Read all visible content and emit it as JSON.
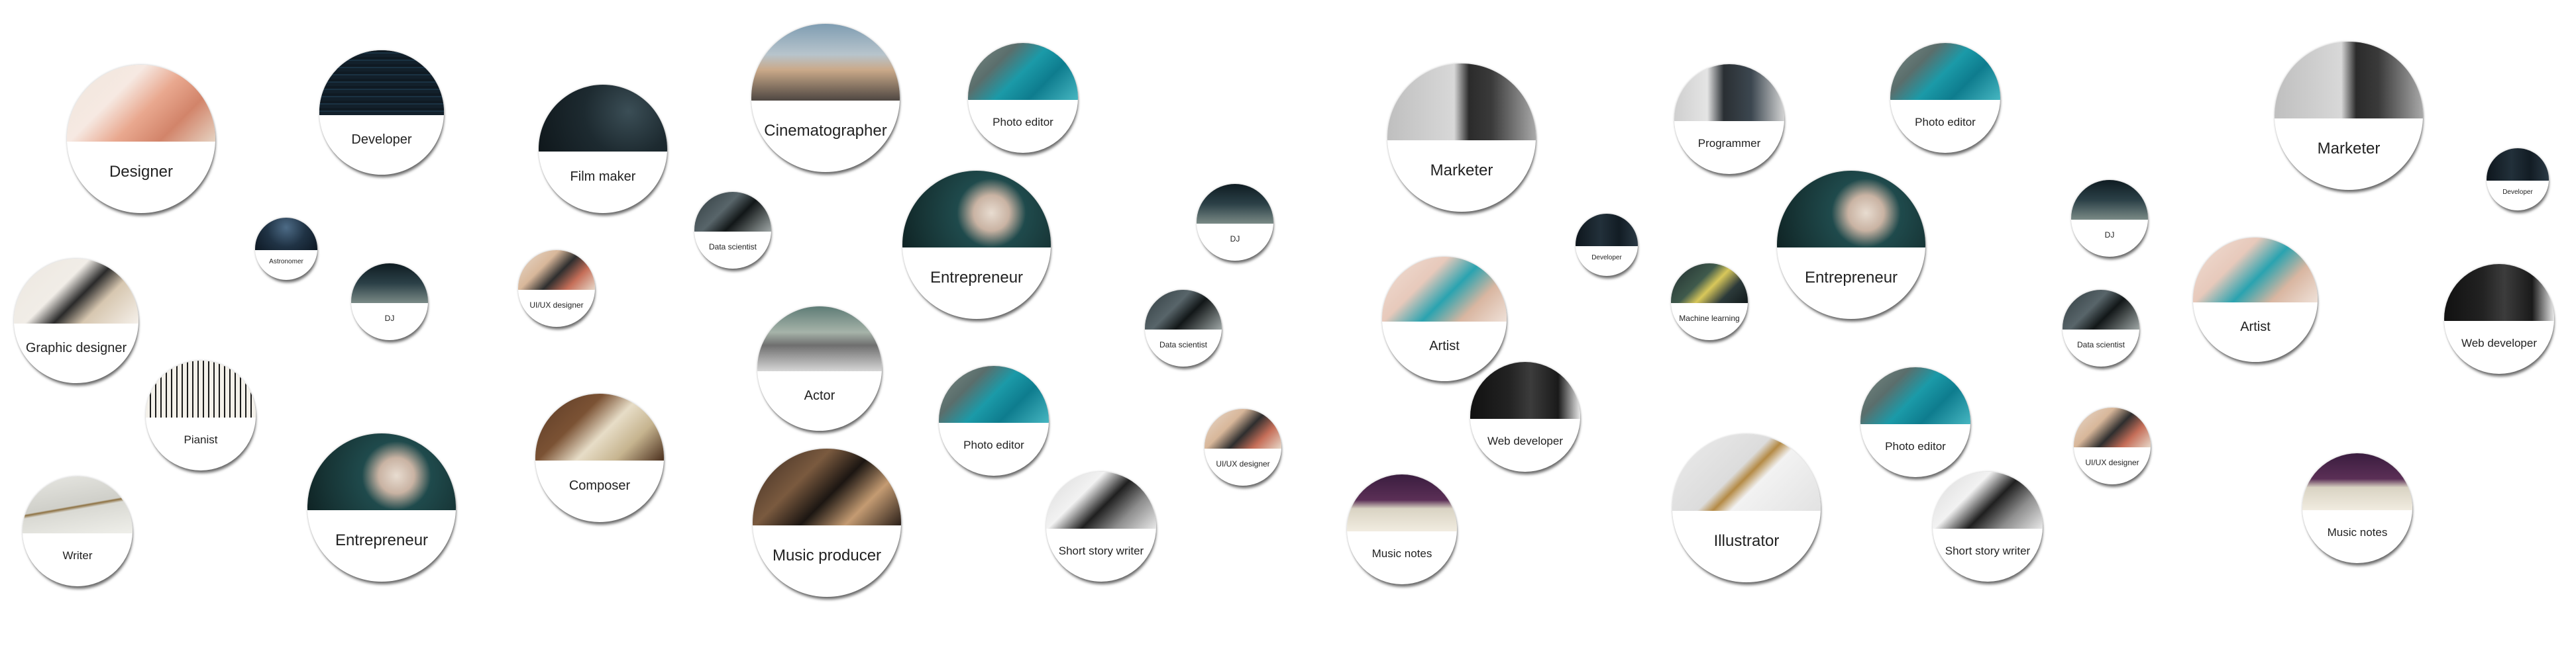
{
  "bubbles": [
    {
      "label": "Designer",
      "theme": "t-designer"
    },
    {
      "label": "Developer",
      "theme": "t-code"
    },
    {
      "label": "Film maker",
      "theme": "t-film"
    },
    {
      "label": "Cinematographer",
      "theme": "t-cine"
    },
    {
      "label": "Photo editor",
      "theme": "t-sea"
    },
    {
      "label": "Marketer",
      "theme": "t-mug"
    },
    {
      "label": "Programmer",
      "theme": "t-program"
    },
    {
      "label": "Photo editor",
      "theme": "t-sea"
    },
    {
      "label": "Marketer",
      "theme": "t-mug"
    },
    {
      "label": "Developer",
      "theme": "t-code2"
    },
    {
      "label": "Astronomer",
      "theme": "t-stars"
    },
    {
      "label": "DJ",
      "theme": "t-dj"
    },
    {
      "label": "UI/UX designer",
      "theme": "t-uiux"
    },
    {
      "label": "Data scientist",
      "theme": "t-datasci"
    },
    {
      "label": "Entrepreneur",
      "theme": "t-mughand"
    },
    {
      "label": "DJ",
      "theme": "t-dj"
    },
    {
      "label": "Developer",
      "theme": "t-code2"
    },
    {
      "label": "Entrepreneur",
      "theme": "t-mughand"
    },
    {
      "label": "DJ",
      "theme": "t-dj"
    },
    {
      "label": "Graphic designer",
      "theme": "t-phone"
    },
    {
      "label": "Data scientist",
      "theme": "t-datasci"
    },
    {
      "label": "Artist",
      "theme": "t-artist"
    },
    {
      "label": "Machine learning",
      "theme": "t-ml"
    },
    {
      "label": "Data scientist",
      "theme": "t-datasci"
    },
    {
      "label": "Artist",
      "theme": "t-artist"
    },
    {
      "label": "Web developer",
      "theme": "t-webdev"
    },
    {
      "label": "Pianist",
      "theme": "t-piano"
    },
    {
      "label": "Actor",
      "theme": "t-actor"
    },
    {
      "label": "Photo editor",
      "theme": "t-sea"
    },
    {
      "label": "Web developer",
      "theme": "t-webdev"
    },
    {
      "label": "Photo editor",
      "theme": "t-sea"
    },
    {
      "label": "Composer",
      "theme": "t-composer"
    },
    {
      "label": "UI/UX designer",
      "theme": "t-uiux"
    },
    {
      "label": "UI/UX designer",
      "theme": "t-uiux"
    },
    {
      "label": "Writer",
      "theme": "t-pen"
    },
    {
      "label": "Entrepreneur",
      "theme": "t-mughand"
    },
    {
      "label": "Music producer",
      "theme": "t-music"
    },
    {
      "label": "Short story writer",
      "theme": "t-laptop"
    },
    {
      "label": "Music notes",
      "theme": "t-notes"
    },
    {
      "label": "Illustrator",
      "theme": "t-illus"
    },
    {
      "label": "Short story writer",
      "theme": "t-laptop"
    },
    {
      "label": "Music notes",
      "theme": "t-notes"
    }
  ]
}
